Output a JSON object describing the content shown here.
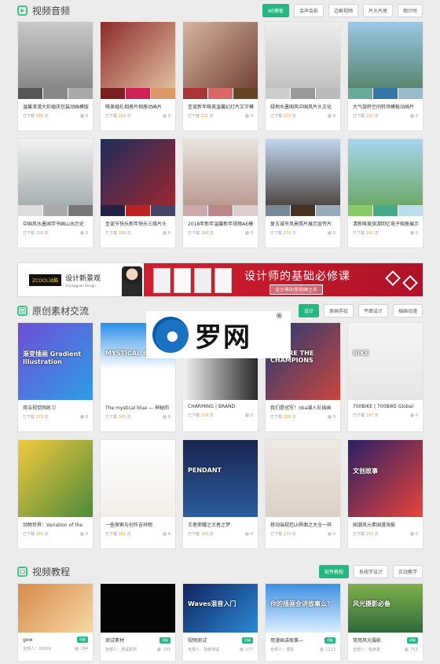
{
  "sections": {
    "video_templates": {
      "title": "视频音频",
      "tabs": [
        "AE模板",
        "会声会影",
        "边框视频",
        "片头片尾",
        "倒计时"
      ]
    },
    "original_exchange": {
      "title": "原创素材交流",
      "tabs": [
        "设计",
        "原画手绘",
        "平面设计",
        "插画动漫"
      ]
    },
    "video_tutorials": {
      "title": "视频教程",
      "tabs": [
        "软件教程",
        "系统学设计",
        "实战教学"
      ]
    }
  },
  "av_cards": [
    {
      "title": "温馨浪漫大彩婚庆包装动画模版",
      "dl_label": "已下载",
      "dl": "386",
      "unit": "次",
      "likes": "0"
    },
    {
      "title": "唯美婚礼相册片相册动画片",
      "dl_label": "已下载",
      "dl": "260",
      "unit": "次",
      "likes": "0"
    },
    {
      "title": "圣诞新年唯美温馨幻灯片文字模",
      "dl_label": "已下载",
      "dl": "231",
      "unit": "次",
      "likes": "0"
    },
    {
      "title": "绿地水墨国风中国风片头文化",
      "dl_label": "已下载",
      "dl": "203",
      "unit": "次",
      "likes": "0"
    },
    {
      "title": "大气旋转空间转场模板动画片",
      "dl_label": "已下载",
      "dl": "192",
      "unit": "次",
      "likes": "0"
    },
    {
      "title": "中国风水墨国学书画山水历史",
      "dl_label": "已下载",
      "dl": "189",
      "unit": "次",
      "likes": "0"
    },
    {
      "title": "圣诞节快乐新年快乐三维片头",
      "dl_label": "已下载",
      "dl": "188",
      "unit": "次",
      "likes": "0"
    },
    {
      "title": "2018年新年温馨新年视频AE模",
      "dl_label": "已下载",
      "dl": "186",
      "unit": "次",
      "likes": "0"
    },
    {
      "title": "复古城市风景照片展示宣传片",
      "dl_label": "已下载",
      "dl": "174",
      "unit": "次",
      "likes": "0"
    },
    {
      "title": "清新唯美旅游回忆电子相册展示",
      "dl_label": "已下载",
      "dl": "142",
      "unit": "次",
      "likes": "0"
    }
  ],
  "banner": {
    "logo": "ZCOOL站酷",
    "brand": "设计新景观",
    "sub": "Xinjingguan Design",
    "main": "设计师的基础必修课",
    "sub2": "设计界的里程碑之作"
  },
  "watermark": {
    "text": "罗网",
    "reg": "®"
  },
  "orig_cards": [
    {
      "title": "简洁视觉网练习",
      "dl_label": "已下载",
      "dl": "373",
      "unit": "次",
      "likes": "0",
      "thumb_text": "渐变插画 Gradient Illustration"
    },
    {
      "title": "The mystical blue — 神秘的",
      "dl_label": "已下载",
      "dl": "345",
      "unit": "次",
      "likes": "0",
      "thumb_text": "MYSTICAL BLUE"
    },
    {
      "title": "CHARMING | BRAND",
      "dl_label": "已下载",
      "dl": "224",
      "unit": "次",
      "likes": "0",
      "thumb_text": ""
    },
    {
      "title": "我们是冠军！nba湖人队插画",
      "dl_label": "已下载",
      "dl": "209",
      "unit": "次",
      "likes": "0",
      "thumb_text": "WE ARE THE CHAMPIONS"
    },
    {
      "title": "700BIKE | 700BIKE Global",
      "dl_label": "已下载",
      "dl": "197",
      "unit": "次",
      "likes": "0",
      "thumb_text": "BIKE"
    },
    {
      "title": "动物世界：Variation of the",
      "dl_label": "已下载",
      "dl": "189",
      "unit": "次",
      "likes": "0",
      "thumb_text": ""
    },
    {
      "title": "一些探索与创作吉祥物",
      "dl_label": "已下载",
      "dl": "181",
      "unit": "次",
      "likes": "0",
      "thumb_text": ""
    },
    {
      "title": "王者荣耀之王者之梦",
      "dl_label": "已下载",
      "dl": "180",
      "unit": "次",
      "likes": "0",
      "thumb_text": "PENDANT"
    },
    {
      "title": "移动端规范UI界面之大全一样",
      "dl_label": "已下载",
      "dl": "179",
      "unit": "次",
      "likes": "0",
      "thumb_text": ""
    },
    {
      "title": "国潮风元素国漫海报",
      "dl_label": "已下载",
      "dl": "155",
      "unit": "次",
      "likes": "0",
      "thumb_text": "文创故事"
    }
  ],
  "tutorials": [
    {
      "title": "gew",
      "tag": "初级",
      "author": "全部人：20009",
      "views": "194",
      "thumb_text": ""
    },
    {
      "title": "测试素材",
      "tag": "初级",
      "author": "全部人：测试素材",
      "views": "193",
      "thumb_text": ""
    },
    {
      "title": "视频测试",
      "tag": "初级",
      "author": "全部人：视频测试",
      "views": "177",
      "thumb_text": "Waves混音入门"
    },
    {
      "title": "用漫画讲故事—",
      "tag": "初级",
      "author": "全部人：漫好",
      "views": "1123",
      "thumb_text": "你的插画会讲故事么？"
    },
    {
      "title": "常用风光摄影",
      "tag": "初级",
      "author": "全部人：帕米夏",
      "views": "751",
      "thumb_text": "风光摄影必备"
    }
  ]
}
